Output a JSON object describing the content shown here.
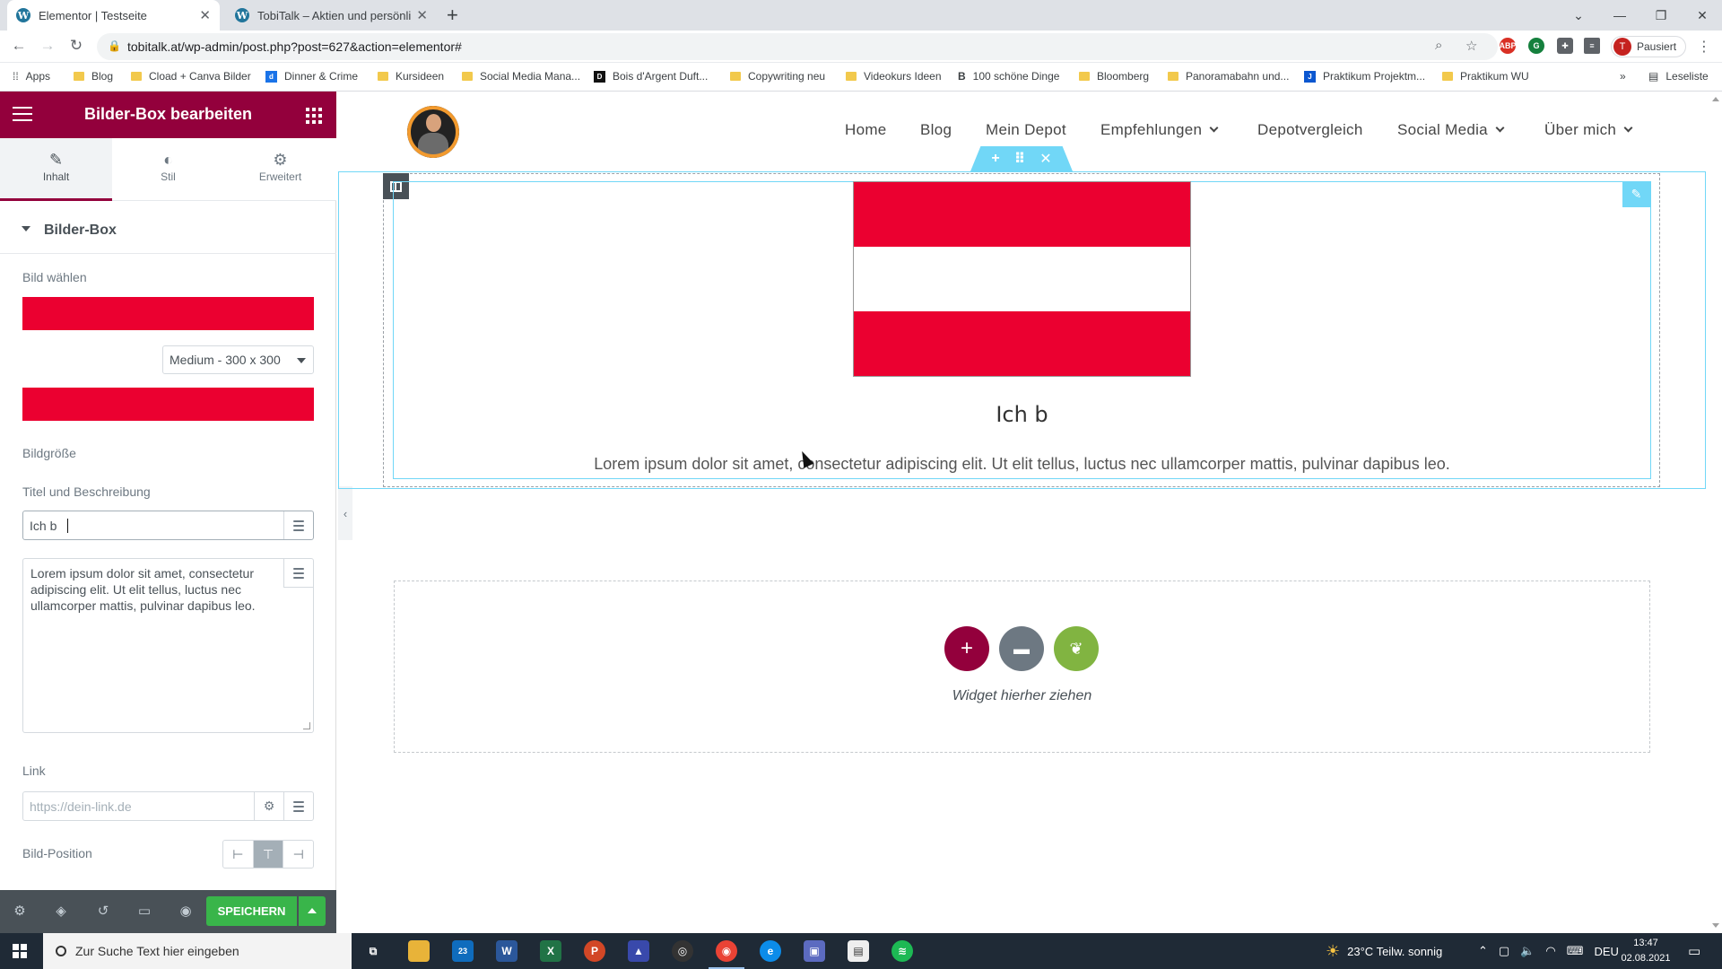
{
  "browser": {
    "tabs": [
      {
        "title": "Elementor | Testseite",
        "active": true
      },
      {
        "title": "TobiTalk – Aktien und persönlich",
        "active": false
      }
    ],
    "url": "tobitalk.at/wp-admin/post.php?post=627&action=elementor#",
    "profile_label": "Pausiert",
    "profile_initial": "T",
    "bookmarks": [
      "Apps",
      "Blog",
      "Cload + Canva Bilder",
      "Dinner & Crime",
      "Kursideen",
      "Social Media Mana...",
      "Bois d'Argent Duft...",
      "Copywriting neu",
      "Videokurs Ideen",
      "100 schöne Dinge",
      "Bloomberg",
      "Panoramabahn und...",
      "Praktikum Projektm...",
      "Praktikum WU"
    ],
    "reading_list": "Leseliste",
    "overflow": "»"
  },
  "panel": {
    "title": "Bilder-Box bearbeiten",
    "tabs": [
      {
        "label": "Inhalt",
        "icon": "pencil-icon",
        "active": true
      },
      {
        "label": "Stil",
        "icon": "contrast-icon",
        "active": false
      },
      {
        "label": "Erweitert",
        "icon": "gear-icon",
        "active": false
      }
    ],
    "section_title": "Bilder-Box",
    "image_label": "Bild wählen",
    "size_label": "Bildgröße",
    "size_value": "Medium - 300 x 300",
    "title_desc_label": "Titel und Beschreibung",
    "title_value": "Ich b",
    "description_value": "Lorem ipsum dolor sit amet, consectetur adipiscing elit. Ut elit tellus, luctus nec ullamcorper mattis, pulvinar dapibus leo.",
    "link_label": "Link",
    "link_placeholder": "https://dein-link.de",
    "position_label": "Bild-Position",
    "position_options": [
      "⊢",
      "⊤",
      "⊣"
    ],
    "save_label": "SPEICHERN"
  },
  "preview": {
    "nav": [
      {
        "label": "Home",
        "dropdown": false
      },
      {
        "label": "Blog",
        "dropdown": false
      },
      {
        "label": "Mein Depot",
        "dropdown": false
      },
      {
        "label": "Empfehlungen",
        "dropdown": true
      },
      {
        "label": "Depotvergleich",
        "dropdown": false
      },
      {
        "label": "Social Media",
        "dropdown": true
      },
      {
        "label": "Über mich",
        "dropdown": true
      }
    ],
    "box_title": "Ich b",
    "box_description": "Lorem ipsum dolor sit amet, consectetur adipiscing elit. Ut elit tellus, luctus nec ullamcorper mattis, pulvinar dapibus leo.",
    "dropzone_text": "Widget hierher ziehen"
  },
  "taskbar": {
    "search_placeholder": "Zur Suche Text hier eingeben",
    "weather": "23°C  Teilw. sonnig",
    "language": "DEU",
    "time": "13:47",
    "date": "02.08.2021",
    "mail_badge": "23"
  },
  "colors": {
    "elementor_brand": "#93003c",
    "flag_red": "#eb0030",
    "selection_blue": "#71d7f7",
    "save_green": "#39b54a",
    "add_button": "#93003c",
    "template_button": "#6d7882",
    "envato_button": "#81b441"
  }
}
